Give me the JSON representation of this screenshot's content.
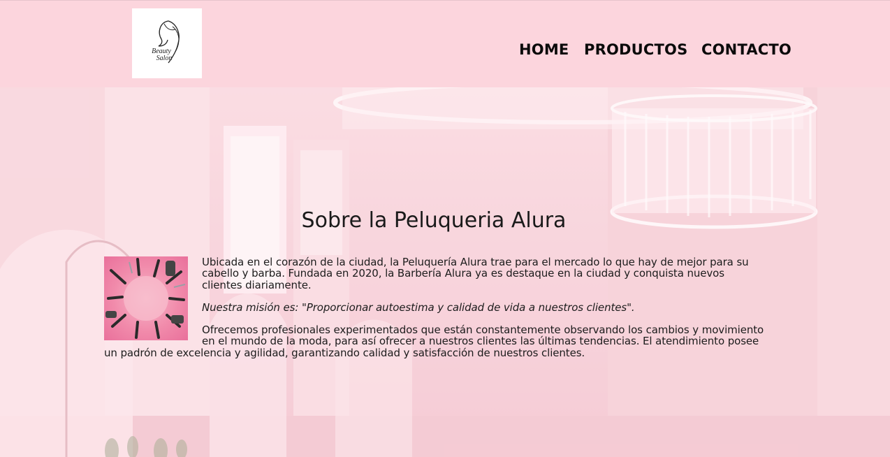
{
  "header": {
    "logo": {
      "icon": "woman-profile-icon",
      "line1": "Beauty",
      "line2": "Salon"
    },
    "nav": {
      "home": "HOME",
      "products": "PRODUCTOS",
      "contact": "CONTACTO"
    }
  },
  "main": {
    "title": "Sobre la Peluqueria Alura",
    "image_icon": "hair-tools-icon",
    "paragraphs": {
      "p1": "Ubicada en el corazón de la ciudad, la Peluquería Alura trae para el mercado lo que hay de mejor para su cabello y barba. Fundada en 2020, la Barbería Alura ya es destaque en la ciudad y conquista nuevos clientes diariamente.",
      "p2": "Nuestra misión es: \"Proporcionar autoestima y calidad de vida a nuestros clientes\".",
      "p3": "Ofrecemos profesionales experimentados que están constantemente observando los cambios y movimiento en el mundo de la moda, para así ofrecer a nuestros clientes las últimas tendencias. El atendimiento posee un padrón de excelencia y agilidad, garantizando calidad y satisfacción de nuestros clientes."
    }
  },
  "colors": {
    "header_bg": "#fcd5dd",
    "hero_pink": "#f4c4cf",
    "text": "#1a1a1a"
  }
}
